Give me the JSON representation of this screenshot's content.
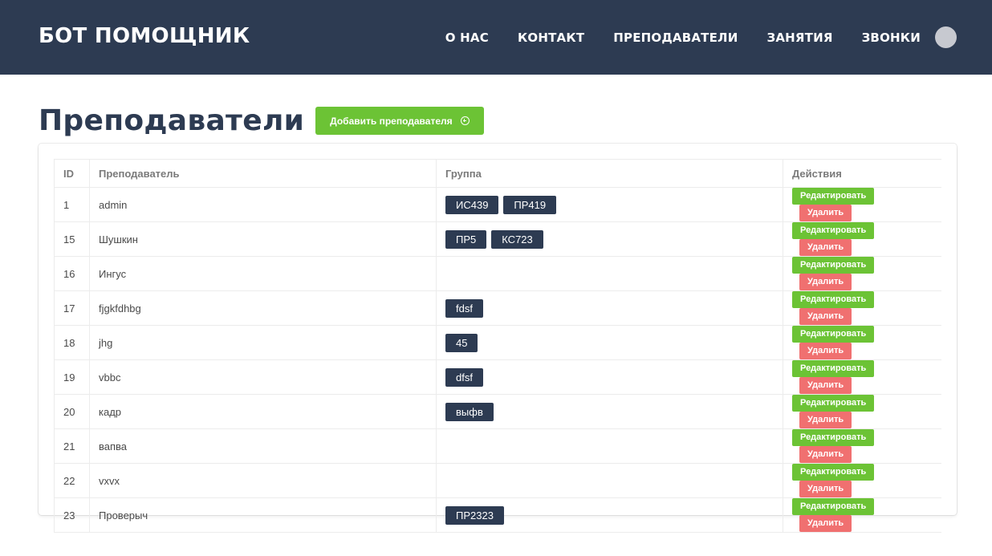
{
  "app": {
    "brand": "БОТ ПОМОЩНИК"
  },
  "nav": {
    "items": [
      "О НАС",
      "КОНТАКТ",
      "ПРЕПОДАВАТЕЛИ",
      "ЗАНЯТИЯ",
      "ЗВОНКИ"
    ]
  },
  "page": {
    "title": "Преподаватели",
    "add_button": "Добавить преподавателя"
  },
  "table": {
    "headers": {
      "id": "ID",
      "teacher": "Преподаватель",
      "group": "Группа",
      "actions": "Действия"
    },
    "edit_label": "Редактировать",
    "delete_label": "Удалить",
    "rows": [
      {
        "id": "1",
        "name": "admin",
        "groups": [
          "ИС439",
          "ПР419"
        ]
      },
      {
        "id": "15",
        "name": "Шушкин",
        "groups": [
          "ПР5",
          "КС723"
        ]
      },
      {
        "id": "16",
        "name": "Ингус",
        "groups": []
      },
      {
        "id": "17",
        "name": "fjgkfdhbg",
        "groups": [
          "fdsf"
        ]
      },
      {
        "id": "18",
        "name": "jhg",
        "groups": [
          "45"
        ]
      },
      {
        "id": "19",
        "name": "vbbc",
        "groups": [
          "dfsf"
        ]
      },
      {
        "id": "20",
        "name": "кадр",
        "groups": [
          "выфв"
        ]
      },
      {
        "id": "21",
        "name": "вапва",
        "groups": []
      },
      {
        "id": "22",
        "name": "vxvx",
        "groups": []
      },
      {
        "id": "23",
        "name": "Проверыч",
        "groups": [
          "ПР2323"
        ]
      }
    ]
  },
  "colors": {
    "navbar": "#2d3b52",
    "success": "#6cc335",
    "danger": "#f07070",
    "tag": "#2d3b52"
  }
}
